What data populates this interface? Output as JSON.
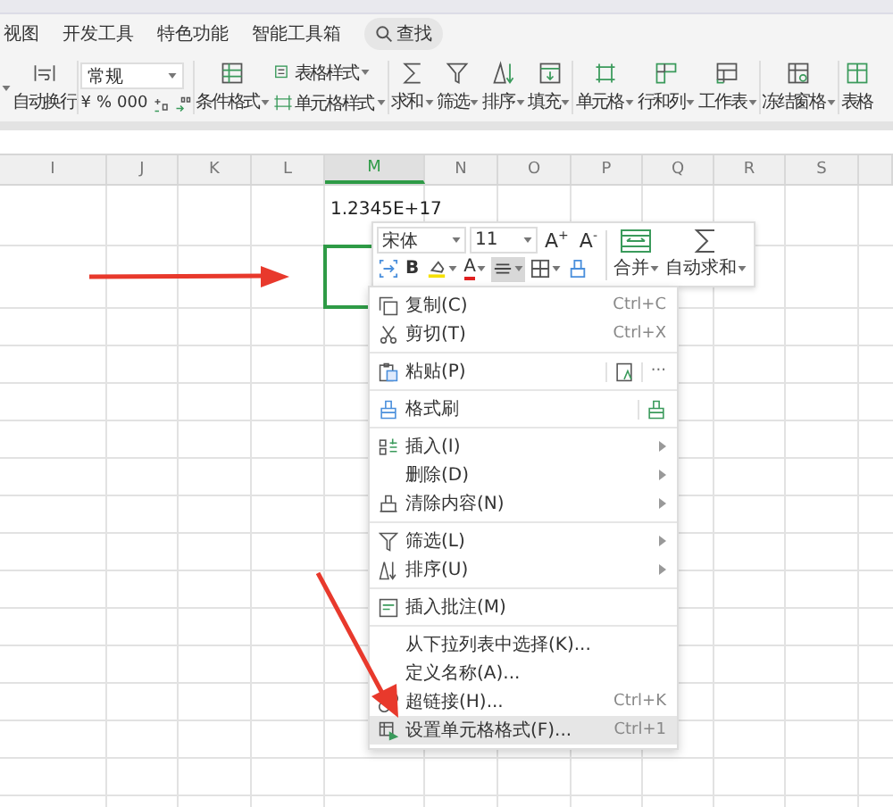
{
  "tabs": [
    {
      "label": "视图"
    },
    {
      "label": "开发工具"
    },
    {
      "label": "特色功能"
    },
    {
      "label": "智能工具箱"
    }
  ],
  "search": {
    "label": "查找"
  },
  "ribbon": {
    "groups": [
      [
        {
          "kind": "large",
          "label": "自动换行",
          "dropdown": false
        }
      ],
      [
        {
          "kind": "number",
          "value": "常规",
          "symbols": [
            "¥",
            "%",
            "000"
          ]
        }
      ],
      [
        {
          "kind": "large",
          "label": "条件格式",
          "dropdown": true
        },
        {
          "kind": "stack",
          "entries": [
            {
              "label": "表格样式",
              "dropdown": true
            },
            {
              "label": "单元格样式",
              "dropdown": true
            }
          ]
        }
      ],
      [
        {
          "kind": "large",
          "label": "求和",
          "dropdown": true
        },
        {
          "kind": "large",
          "label": "筛选",
          "dropdown": true
        },
        {
          "kind": "large",
          "label": "排序",
          "dropdown": true
        },
        {
          "kind": "large",
          "label": "填充",
          "dropdown": true
        }
      ],
      [
        {
          "kind": "large",
          "label": "单元格",
          "dropdown": true
        },
        {
          "kind": "large",
          "label": "行和列",
          "dropdown": true
        },
        {
          "kind": "large",
          "label": "工作表",
          "dropdown": true
        }
      ],
      [
        {
          "kind": "large",
          "label": "冻结窗格",
          "dropdown": true
        }
      ],
      [
        {
          "kind": "large",
          "label": "表格",
          "dropdown": false
        }
      ]
    ]
  },
  "sheet": {
    "columns": [
      {
        "label": "I",
        "selected": false
      },
      {
        "label": "J",
        "selected": false
      },
      {
        "label": "K",
        "selected": false
      },
      {
        "label": "L",
        "selected": false
      },
      {
        "label": "M",
        "selected": true,
        "top_cell": "1.2345E+17"
      },
      {
        "label": "N",
        "selected": false
      },
      {
        "label": "O",
        "selected": false
      },
      {
        "label": "P",
        "selected": false
      },
      {
        "label": "Q",
        "selected": false
      },
      {
        "label": "R",
        "selected": false
      },
      {
        "label": "S",
        "selected": false
      }
    ]
  },
  "mini_toolbar": {
    "font": "宋体",
    "size": "11",
    "grow": "A$^{+}$",
    "shrink": "A$^{-}$",
    "merge_label": "合并",
    "sum_label": "自动求和",
    "buttons": [
      {
        "kind": "wrap",
        "selected": false,
        "dropdown": false
      },
      {
        "kind": "text",
        "label": "B",
        "selected": false,
        "dropdown": false
      },
      {
        "kind": "fill",
        "selected": false,
        "dropdown": true
      },
      {
        "kind": "font-color",
        "label": "A",
        "selected": false,
        "dropdown": true
      },
      {
        "kind": "align",
        "selected": true,
        "dropdown": true
      },
      {
        "kind": "border",
        "selected": false,
        "dropdown": true
      },
      {
        "kind": "clear",
        "selected": false,
        "dropdown": false
      }
    ]
  },
  "context_menu": [
    {
      "kind": "item",
      "label": "复制(C)",
      "shortcut": "Ctrl+C",
      "submenu": false,
      "selected": false
    },
    {
      "kind": "item",
      "label": "剪切(T)",
      "shortcut": "Ctrl+X",
      "submenu": false,
      "selected": false
    },
    {
      "kind": "separator"
    },
    {
      "kind": "item",
      "label": "粘贴(P)",
      "trailing": "···",
      "submenu": false,
      "selected": false
    },
    {
      "kind": "separator"
    },
    {
      "kind": "item",
      "label": "格式刷",
      "submenu": false,
      "selected": false
    },
    {
      "kind": "separator"
    },
    {
      "kind": "item",
      "label": "插入(I)",
      "submenu": true,
      "selected": false
    },
    {
      "kind": "item",
      "label": "删除(D)",
      "submenu": true,
      "selected": false
    },
    {
      "kind": "item",
      "label": "清除内容(N)",
      "submenu": true,
      "selected": false
    },
    {
      "kind": "separator"
    },
    {
      "kind": "item",
      "label": "筛选(L)",
      "submenu": true,
      "selected": false
    },
    {
      "kind": "item",
      "label": "排序(U)",
      "submenu": true,
      "selected": false
    },
    {
      "kind": "separator"
    },
    {
      "kind": "item",
      "label": "插入批注(M)",
      "submenu": false,
      "selected": false
    },
    {
      "kind": "separator"
    },
    {
      "kind": "item",
      "label": "从下拉列表中选择(K)...",
      "submenu": false,
      "selected": false
    },
    {
      "kind": "item",
      "label": "定义名称(A)...",
      "submenu": false,
      "selected": false
    },
    {
      "kind": "item",
      "label": "超链接(H)...",
      "shortcut": "Ctrl+K",
      "submenu": false,
      "selected": false
    },
    {
      "kind": "item",
      "label": "设置单元格格式(F)...",
      "shortcut": "Ctrl+1",
      "submenu": false,
      "selected": true
    }
  ],
  "annotations": [
    {
      "kind": "arrow"
    },
    {
      "kind": "arrow"
    }
  ]
}
